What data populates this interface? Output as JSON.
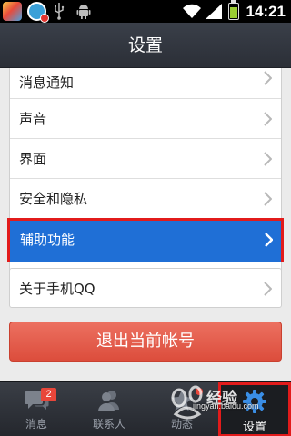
{
  "status_bar": {
    "time": "14:21",
    "icons": [
      "app-icon",
      "qq-security-icon",
      "usb-icon",
      "android-debug-icon",
      "wifi-icon",
      "signal-icon",
      "battery-icon"
    ]
  },
  "header": {
    "title": "设置"
  },
  "settings": {
    "items": [
      {
        "label": "消息通知"
      },
      {
        "label": "声音"
      },
      {
        "label": "界面"
      },
      {
        "label": "安全和隐私"
      },
      {
        "label": "辅助功能",
        "highlighted": true
      }
    ],
    "about": {
      "label": "关于手机QQ"
    },
    "logout_label": "退出当前帐号"
  },
  "tab_bar": {
    "tabs": [
      {
        "label": "消息",
        "icon": "chat-bubbles-icon",
        "badge": "2"
      },
      {
        "label": "联系人",
        "icon": "contacts-icon"
      },
      {
        "label": "动态",
        "icon": "star-icon",
        "dot": true
      },
      {
        "label": "设置",
        "icon": "gear-icon",
        "selected": true
      }
    ]
  },
  "watermark": {
    "text": "jingyan.baidu.com"
  },
  "colors": {
    "highlight": "#1f6fd6",
    "highlight_border": "#e21b1b",
    "logout": "#e05a48",
    "badge": "#e8463a"
  }
}
